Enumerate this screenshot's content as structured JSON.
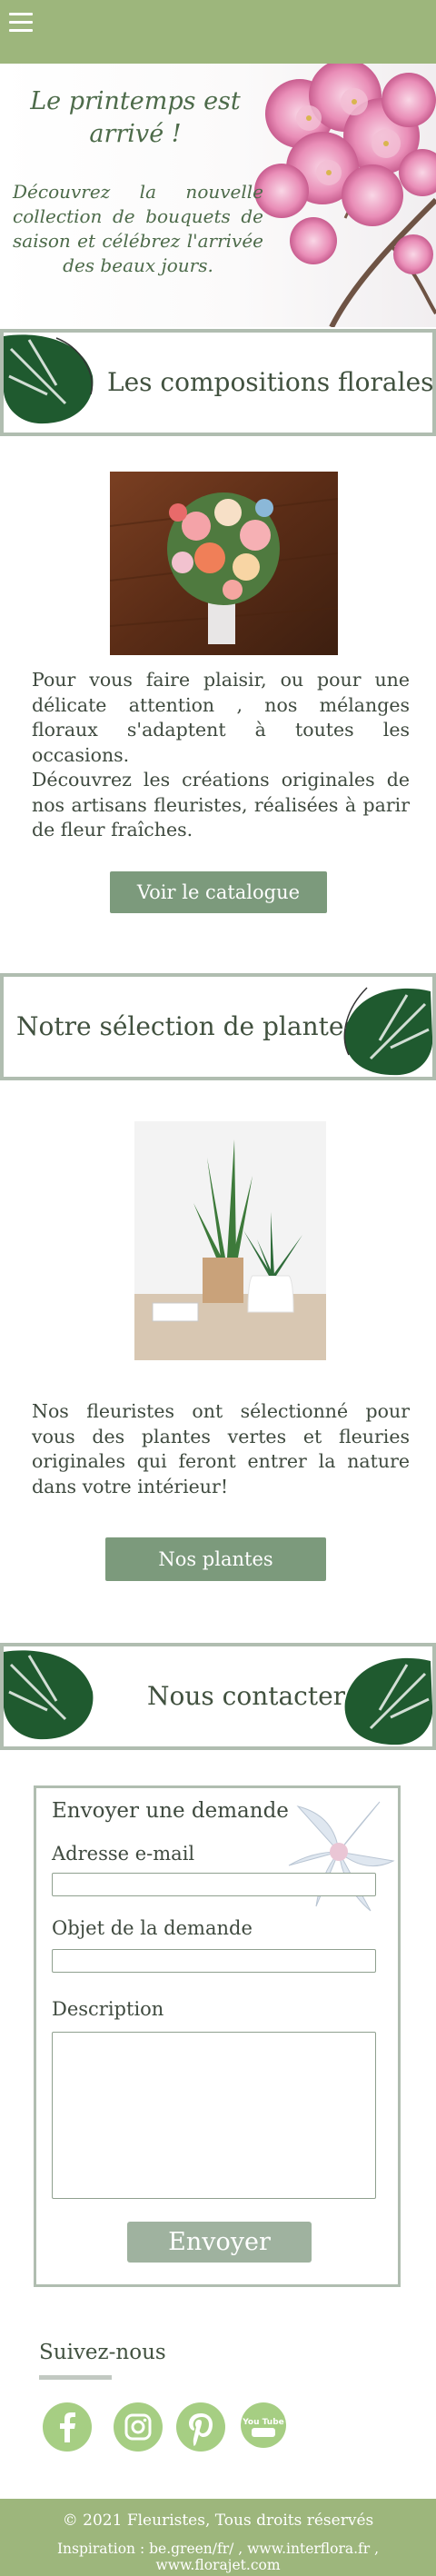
{
  "hero": {
    "title": "Le printemps est arrivé !",
    "text": "Découvrez la nouvelle collection de bouquets de saison et célébrez l'arrivée des beaux jours."
  },
  "compositions": {
    "title": "Les compositions florales",
    "text1": "Pour vous faire plaisir, ou pour une délicate attention , nos mélanges floraux s'adaptent à toutes les occasions.",
    "text2": "Découvrez les créations originales de nos artisans fleuristes, réalisées à parir de fleur fraîches.",
    "button": "Voir le catalogue"
  },
  "plantes": {
    "title": "Notre sélection de plantes",
    "text": "Nos fleuristes ont sélectionné pour vous des plantes vertes et fleuries originales qui feront entrer la nature dans votre intérieur!",
    "button": "Nos plantes"
  },
  "contact": {
    "title": "Nous contacter",
    "form_title": "Envoyer une demande",
    "email_label": "Adresse e-mail",
    "subject_label": "Objet de la demande",
    "description_label": "Description",
    "send": "Envoyer"
  },
  "social": {
    "title": "Suivez-nous",
    "youtube_text": "You Tube"
  },
  "footer": {
    "copyright": "© 2021  Fleuristes, Tous droits réservés",
    "inspiration": "Inspiration : be.green/fr/ , www.interflora.fr , www.florajet.com"
  },
  "colors": {
    "brand_green": "#9db67c",
    "button_green": "#7c9a7c",
    "social_green": "#a6ce83"
  }
}
